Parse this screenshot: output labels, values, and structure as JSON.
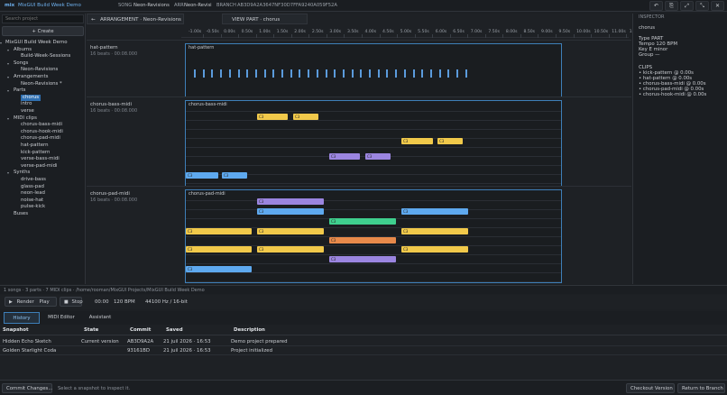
{
  "topbar": {
    "app_badge": "mix",
    "project": "MixGUI Build Week Demo",
    "song_label": "SONG",
    "song": "Neon-Revisions",
    "arr_label": "ARR",
    "arr": "Neon-Revisi",
    "branch_label": "BRANCH",
    "branch": "AB3D9A2A3647NF30D7FFA9240A059F52A",
    "window_buttons": [
      "↶",
      "⎘",
      "⤢",
      "⤡",
      "✕"
    ]
  },
  "sidebar": {
    "search_placeholder": "Search project",
    "create_label": "+  Create",
    "tree": [
      {
        "label": "MixGUI Build Week Demo",
        "depth": 0,
        "toggle": "▾"
      },
      {
        "label": "Albums",
        "depth": 1,
        "toggle": "▾"
      },
      {
        "label": "Build-Week-Sessions",
        "depth": 2,
        "toggle": ""
      },
      {
        "label": "Songs",
        "depth": 1,
        "toggle": "▾"
      },
      {
        "label": "Neon-Revisions",
        "depth": 2,
        "toggle": ""
      },
      {
        "label": "Arrangements",
        "depth": 1,
        "toggle": "▾"
      },
      {
        "label": "Neon-Revisions *",
        "depth": 2,
        "toggle": ""
      },
      {
        "label": "Parts",
        "depth": 1,
        "toggle": "▾"
      },
      {
        "label": "chorus",
        "depth": 2,
        "toggle": "",
        "selected": true
      },
      {
        "label": "intro",
        "depth": 2,
        "toggle": ""
      },
      {
        "label": "verse",
        "depth": 2,
        "toggle": ""
      },
      {
        "label": "MIDI clips",
        "depth": 1,
        "toggle": "▾"
      },
      {
        "label": "chorus-bass-midi",
        "depth": 2,
        "toggle": ""
      },
      {
        "label": "chorus-hook-midi",
        "depth": 2,
        "toggle": ""
      },
      {
        "label": "chorus-pad-midi",
        "depth": 2,
        "toggle": ""
      },
      {
        "label": "hat-pattern",
        "depth": 2,
        "toggle": ""
      },
      {
        "label": "kick-pattern",
        "depth": 2,
        "toggle": ""
      },
      {
        "label": "verse-bass-midi",
        "depth": 2,
        "toggle": ""
      },
      {
        "label": "verse-pad-midi",
        "depth": 2,
        "toggle": ""
      },
      {
        "label": "Synths",
        "depth": 1,
        "toggle": "▾"
      },
      {
        "label": "drive-bass",
        "depth": 2,
        "toggle": ""
      },
      {
        "label": "glass-pad",
        "depth": 2,
        "toggle": ""
      },
      {
        "label": "neon-lead",
        "depth": 2,
        "toggle": ""
      },
      {
        "label": "noise-hat",
        "depth": 2,
        "toggle": ""
      },
      {
        "label": "pulse-kick",
        "depth": 2,
        "toggle": ""
      },
      {
        "label": "Buses",
        "depth": 1,
        "toggle": ""
      }
    ]
  },
  "editor": {
    "back_arrow": "←",
    "arrangement_tab": "ARRANGEMENT  ·  Neon-Revisions",
    "view_tab": "VIEW  PART  ·  chorus",
    "ruler": [
      "-1.00s",
      "-0.50s",
      "0.00s",
      "0.50s",
      "1.00s",
      "1.50s",
      "2.00s",
      "2.50s",
      "3.00s",
      "3.50s",
      "4.00s",
      "4.50s",
      "5.00s",
      "5.50s",
      "6.00s",
      "6.50s",
      "7.00s",
      "7.50s",
      "8.00s",
      "8.50s",
      "9.00s",
      "9.50s",
      "10.00s",
      "10.50s",
      "11.00s",
      "11.50s",
      "12.00s"
    ],
    "tracks": [
      {
        "name": "hat-pattern",
        "info": "16 beats · 00:08.000",
        "clip": "hat-pattern"
      },
      {
        "name": "chorus-bass-midi",
        "info": "16 beats · 00:08.000",
        "clip": "chorus-bass-midi"
      },
      {
        "name": "chorus-pad-midi",
        "info": "16 beats · 00:08.000",
        "clip": "chorus-pad-midi"
      }
    ],
    "note_label": "C3"
  },
  "inspector": {
    "title": "INSPECTOR",
    "name": "chorus",
    "type": "Type   PART",
    "tempo": "Tempo  120 BPM",
    "key": "Key    E minor",
    "group": "Group  —",
    "clips_title": "CLIPS",
    "clips": [
      "• kick-pattern  @ 0.00s",
      "• hat-pattern  @ 0.00s",
      "• chorus-bass-midi  @ 0.00s",
      "• chorus-pad-midi  @ 0.00s",
      "• chorus-hook-midi  @ 0.00s"
    ]
  },
  "statusline": "1 songs  ·  3 parts  ·  7 MIDI clips  ·  /home/rooman/MixGUI Projects/MixGUI Build Week Demo",
  "transport": {
    "render": "Render",
    "play": "Play",
    "stop": "Stop",
    "time": "00:00",
    "tempo": "120 BPM",
    "format": "44100 Hz / 16-bit"
  },
  "panel_tabs": [
    "History",
    "MIDI Editor",
    "Assistant"
  ],
  "history": {
    "columns": [
      "Snapshot",
      "State",
      "Commit",
      "Saved",
      "Description"
    ],
    "rows": [
      [
        "Hidden Echo Sketch",
        "Current version",
        "AB3D9A2A",
        "21 juil 2026  ·  16:53",
        "Demo project prepared"
      ],
      [
        "Golden Starlight Coda",
        "",
        "93161BD",
        "21 juil 2026  ·  16:53",
        "Project initialized"
      ]
    ]
  },
  "bottombar": {
    "commit": "Commit Changes...",
    "hint": "Select a snapshot to inspect it.",
    "checkout": "Checkout Version",
    "return": "Return to Branch"
  },
  "colors": {
    "accent": "#2f6fb0",
    "lane_border": "#3e7fb8",
    "hat": "#5b9bdc",
    "yellow": "#f1c94a",
    "blue": "#5ea9ef",
    "purple": "#9b85e0",
    "green": "#3fcf8e",
    "orange": "#e8894a"
  }
}
